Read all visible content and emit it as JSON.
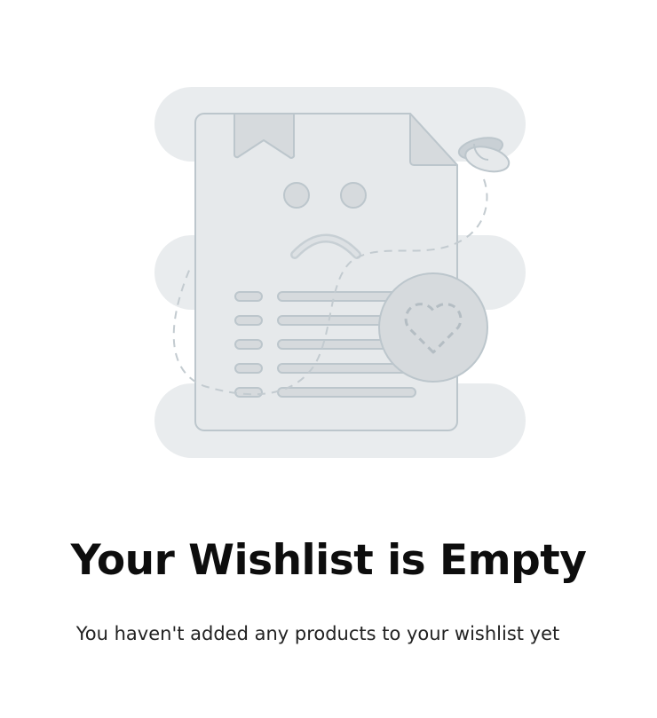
{
  "empty_state": {
    "title": "Your Wishlist is Empty",
    "message": "You haven't added any products to your wishlist yet",
    "illustration_icon": "sad-document-heart-icon"
  },
  "colors": {
    "background": "#ffffff",
    "title_text": "#0d0d0d",
    "message_text": "#222222",
    "illustration_blob": "#e9ecee",
    "illustration_stroke": "#bcc6cc",
    "illustration_fill": "#d6dadd"
  }
}
